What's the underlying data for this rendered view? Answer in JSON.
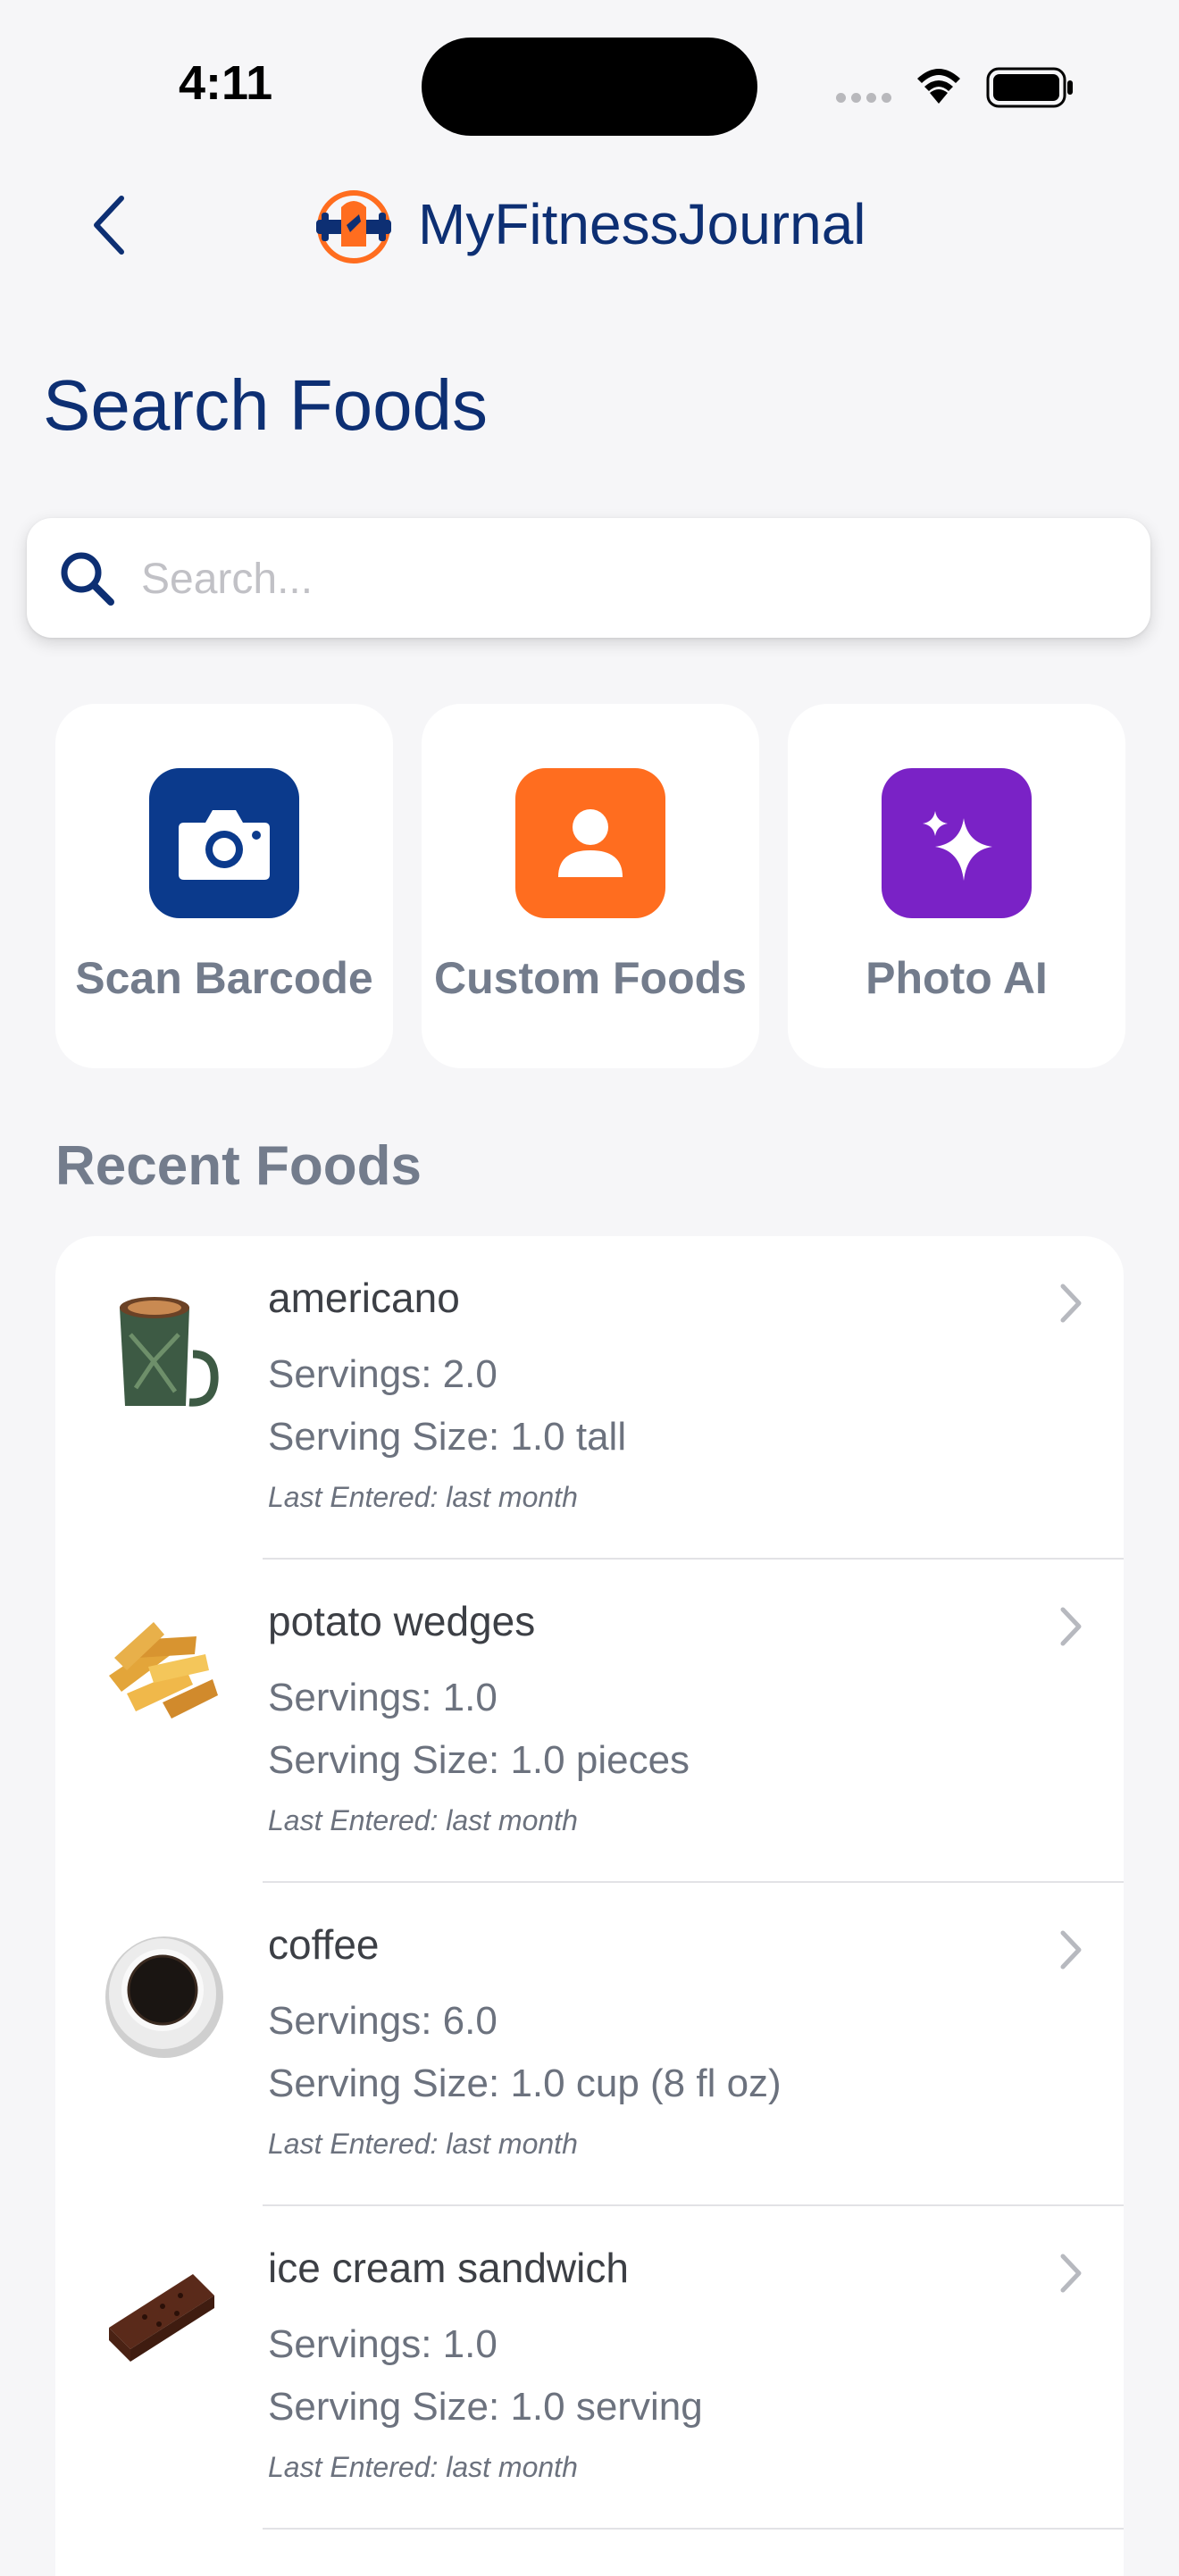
{
  "status_bar": {
    "time": "4:11"
  },
  "header": {
    "app_title": "MyFitnessJournal"
  },
  "page": {
    "title": "Search Foods"
  },
  "search": {
    "placeholder": "Search..."
  },
  "actions": [
    {
      "label": "Scan Barcode",
      "icon": "camera-icon",
      "color": "#0b3a8c"
    },
    {
      "label": "Custom Foods",
      "icon": "person-icon",
      "color": "#ff6d1f"
    },
    {
      "label": "Photo AI",
      "icon": "sparkles-icon",
      "color": "#7a22c6"
    }
  ],
  "recent": {
    "title": "Recent Foods",
    "items": [
      {
        "name": "americano",
        "servings": "Servings: 2.0",
        "size": "Serving Size: 1.0 tall",
        "last": "Last Entered: last month",
        "image": "americano-mug"
      },
      {
        "name": "potato wedges",
        "servings": "Servings: 1.0",
        "size": "Serving Size: 1.0 pieces",
        "last": "Last Entered: last month",
        "image": "potato-wedges"
      },
      {
        "name": "coffee",
        "servings": "Servings: 6.0",
        "size": "Serving Size: 1.0 cup (8 fl oz)",
        "last": "Last Entered: last month",
        "image": "coffee-cup"
      },
      {
        "name": "ice cream sandwich",
        "servings": "Servings: 1.0",
        "size": "Serving Size: 1.0 serving",
        "last": "Last Entered: last month",
        "image": "ice-cream-sandwich"
      }
    ]
  }
}
